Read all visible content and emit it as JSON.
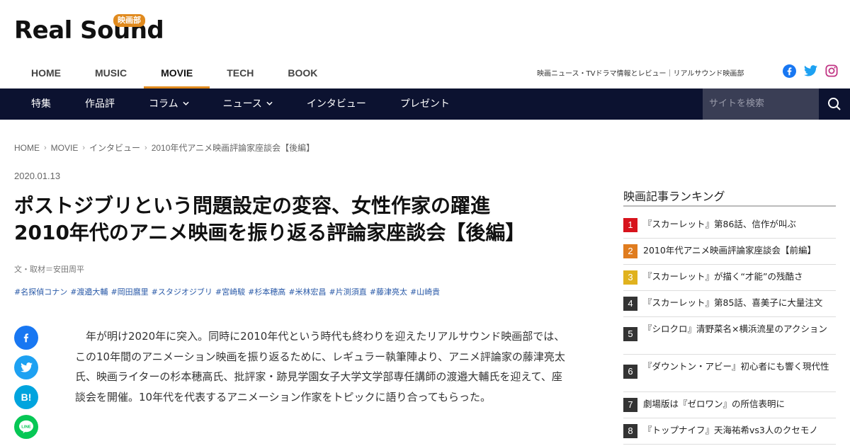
{
  "brand": {
    "logo_text": "Real Sound",
    "badge": "映画部",
    "accent": "#e08a1e"
  },
  "main_nav": {
    "items": [
      "HOME",
      "MUSIC",
      "MOVIE",
      "TECH",
      "BOOK"
    ],
    "active": "MOVIE"
  },
  "tagline": "映画ニュース・TVドラマ情報とレビュー｜リアルサウンド映画部",
  "social_icons": [
    "facebook-icon",
    "twitter-icon",
    "instagram-icon"
  ],
  "sub_nav": {
    "items": [
      {
        "label": "特集",
        "dropdown": false
      },
      {
        "label": "作品評",
        "dropdown": false
      },
      {
        "label": "コラム",
        "dropdown": true
      },
      {
        "label": "ニュース",
        "dropdown": true
      },
      {
        "label": "インタビュー",
        "dropdown": false
      },
      {
        "label": "プレゼント",
        "dropdown": false
      }
    ],
    "search_placeholder": "サイトを検索",
    "bg_color": "#0c1230"
  },
  "breadcrumb": [
    "HOME",
    "MOVIE",
    "インタビュー",
    "2010年代アニメ映画評論家座談会【後編】"
  ],
  "article": {
    "date": "2020.01.13",
    "title_line1": "ポストジブリという問題設定の変容、女性作家の躍進",
    "title_line2": "2010年代のアニメ映画を振り返る評論家座談会【後編】",
    "byline": "文・取材＝安田周平",
    "tags": [
      "#名探偵コナン",
      "#渡邉大輔",
      "#岡田麿里",
      "#スタジオジブリ",
      "#宮崎駿",
      "#杉本穂高",
      "#米林宏昌",
      "#片渕須直",
      "#藤津亮太",
      "#山崎貴"
    ],
    "body": "年が明け2020年に突入。同時に2010年代という時代も終わりを迎えたリアルサウンド映画部では、この10年間のアニメーション映画を振り返るために、レギュラー執筆陣より、アニメ評論家の藤津亮太氏、映画ライターの杉本穂高氏、批評家・跡見学園女子大学文学部専任講師の渡邉大輔氏を迎えて、座談会を開催。10年代を代表するアニメーション作家をトピックに語り合ってもらった。"
  },
  "share_buttons": [
    {
      "name": "facebook-share-button",
      "color": "#1877f2",
      "label": "f"
    },
    {
      "name": "twitter-share-button",
      "color": "#1da1f2",
      "label": "t"
    },
    {
      "name": "hatena-share-button",
      "color": "#00a4de",
      "label": "B!"
    },
    {
      "name": "line-share-button",
      "color": "#06c755",
      "label": "LINE"
    }
  ],
  "ranking": {
    "title": "映画記事ランキング",
    "items": [
      {
        "rank": "1",
        "text": "『スカーレット』第86話、信作が叫ぶ",
        "color": "#d7131c"
      },
      {
        "rank": "2",
        "text": "2010年代アニメ映画評論家座談会【前編】",
        "color": "#e07c1e"
      },
      {
        "rank": "3",
        "text": "『スカーレット』が描く“才能”の残酷さ",
        "color": "#e0b21e"
      },
      {
        "rank": "4",
        "text": "『スカーレット』第85話、喜美子に大量注文",
        "color": "#333333"
      },
      {
        "rank": "5",
        "text": "『シロクロ』清野菜名×横浜流星のアクション",
        "color": "#333333"
      },
      {
        "rank": "6",
        "text": "『ダウントン・アビー』初心者にも響く現代性",
        "color": "#333333"
      },
      {
        "rank": "7",
        "text": "劇場版は『ゼロワン』の所信表明に",
        "color": "#333333"
      },
      {
        "rank": "8",
        "text": "『トップナイフ』天海祐希vs3人のクセモノ",
        "color": "#333333"
      }
    ]
  }
}
